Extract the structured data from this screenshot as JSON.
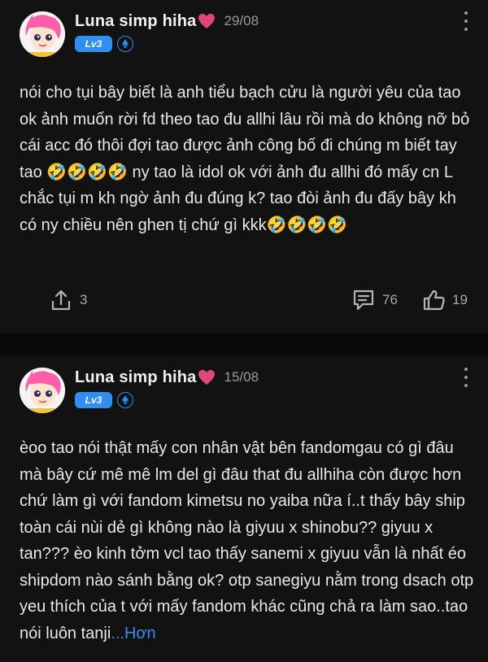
{
  "posts": [
    {
      "author": "Luna simp hiha",
      "date": "29/08",
      "level": "Lv3",
      "content": "nói cho tụi bây biết là anh tiểu bạch cửu là người yêu của tao ok ảnh muốn rời fd theo tao đu allhi lâu rồi mà do không nỡ bỏ cái acc đó thôi đợi tao được ảnh công bố đi chúng m biết tay tao 🤣🤣🤣🤣 ny tao là idol ok với ảnh đu allhi đó mấy cn L chắc tụi m kh ngờ ảnh đu đúng k? tao đòi ảnh đu đấy bây kh có ny chiều nên ghen tị chứ gì kkk🤣🤣🤣🤣",
      "shares": "3",
      "comments": "76",
      "likes": "19"
    },
    {
      "author": "Luna simp hiha",
      "date": "15/08",
      "level": "Lv3",
      "content": "èoo tao nói thật mấy con nhân vật bên fandomgau có gì đâu mà bây cứ mê mê lm del gì đâu that đu allhiha còn được hơn chứ làm gì với fandom kimetsu no yaiba nữa í..t thấy bây ship toàn cái nùi dẻ gì không nào là giyuu x shinobu?? giyuu x tan??? èo kinh tởm vcl tao thấy sanemi x giyuu vẫn là nhất éo shipdom nào sánh bằng ok? otp sanegiyu nằm trong dsach otp yeu thích của t với mấy fandom khác cũng chả ra làm sao..tao nói luôn tanji",
      "more_link": "...Hơn"
    }
  ],
  "icons": {
    "heart": "heart-icon",
    "verified": "ethereum-icon",
    "more": "more-vertical-icon",
    "share": "share-icon",
    "comment": "comment-icon",
    "like": "thumbs-up-icon"
  },
  "colors": {
    "background": "#121212",
    "accent": "#2f8ef0",
    "heart": "#e0457b"
  }
}
